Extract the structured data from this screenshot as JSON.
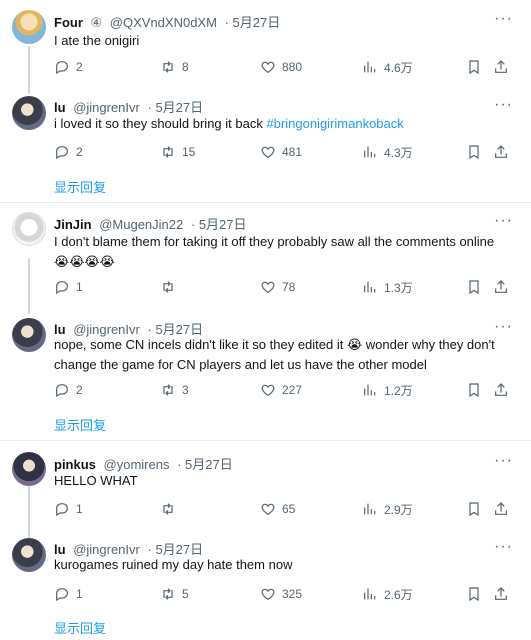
{
  "more_glyph": "···",
  "tweets": [
    {
      "name": "Four",
      "verified_glyph": "④",
      "handle": "@QXVndXN0dXM",
      "date": "5月27日",
      "text": "I ate the onigiri",
      "reply": "2",
      "retweet": "8",
      "like": "880",
      "views": "4.6万",
      "avatar": "four"
    },
    {
      "name": "lu",
      "handle": "@jingrenIvr",
      "date": "5月27日",
      "text_prefix": "i loved it so they should bring it back ",
      "hashtag": "#bringonigirimankoback",
      "reply": "2",
      "retweet": "15",
      "like": "481",
      "views": "4.3万",
      "show_replies": "显示回复",
      "avatar": "lu"
    },
    {
      "name": "JinJin",
      "handle": "@MugenJin22",
      "date": "5月27日",
      "text": "I don't blame them for taking it off they probably saw all the comments online😭😭😭😭",
      "reply": "1",
      "retweet": "",
      "like": "78",
      "views": "1.3万",
      "avatar": "jinjin"
    },
    {
      "name": "lu",
      "handle": "@jingrenIvr",
      "date": "5月27日",
      "text": "nope, some CN incels didn't like it so they edited it 😭 wonder why they don't change the game for CN players and let us have the other model",
      "reply": "2",
      "retweet": "3",
      "like": "227",
      "views": "1.2万",
      "show_replies": "显示回复",
      "avatar": "lu"
    },
    {
      "name": "pinkus",
      "handle": "@yomirens",
      "date": "5月27日",
      "text": "HELLO WHAT",
      "reply": "1",
      "retweet": "",
      "like": "65",
      "views": "2.9万",
      "avatar": "pinkus"
    },
    {
      "name": "lu",
      "handle": "@jingrenIvr",
      "date": "5月27日",
      "text": "kurogames ruined my day hate them now",
      "reply": "1",
      "retweet": "5",
      "like": "325",
      "views": "2.6万",
      "show_replies": "显示回复",
      "avatar": "lu"
    }
  ]
}
